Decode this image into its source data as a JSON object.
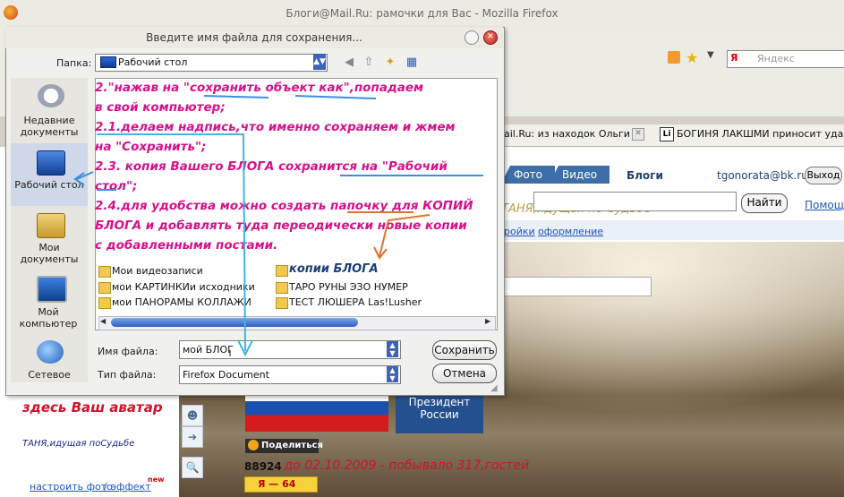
{
  "window": {
    "title": "Блоги@Mail.Ru: рамочки для Вас - Mozilla Firefox"
  },
  "browser": {
    "search_placeholder": "Яндекс",
    "search_logo": "Я",
    "tabs": [
      {
        "label": "ail.Ru: из находок Ольги ..."
      },
      {
        "label": "БОГИНЯ ЛАКШМИ приносит удачу,...",
        "icon_text": "Li"
      }
    ]
  },
  "page": {
    "nav_tabs": [
      "Фото",
      "Видео"
    ],
    "nav_active": "Блоги",
    "user_email": "tgonorata@bk.ru",
    "logout_label": "Выход",
    "find_label": "Найти",
    "help_link": "Помощ",
    "ghost_text": "ТАНЯ,идущая по Судьбе",
    "links": [
      "ройки",
      "оформление"
    ],
    "avatar_text": "здесь Ваш аватар",
    "avatar_sub": "ТАНЯ,идущая поСудьбе",
    "photo_link": "настроить фото",
    "effect_link": "эффект",
    "separator": "/",
    "new_badge": "new",
    "president_text": "Президент России",
    "share_label": "Поделиться",
    "counter": "88924",
    "counter_text": "- до 02.10.2009 - побывало 317,гостей",
    "ya_badge": "Я — 64"
  },
  "dialog": {
    "title": "Введите имя файла для сохранения...",
    "folder_label": "Папка:",
    "folder_value": "Рабочий стол",
    "places": [
      {
        "label": "Недавние документы",
        "icon": "recent-docs-icon"
      },
      {
        "label": "Рабочий стол",
        "icon": "desktop-icon",
        "selected": true
      },
      {
        "label": "Мои документы",
        "icon": "my-documents-icon"
      },
      {
        "label": "Мой компьютер",
        "icon": "my-computer-icon"
      },
      {
        "label": "Сетевое",
        "icon": "network-icon"
      }
    ],
    "files": [
      {
        "name": "Мои видеозаписи"
      },
      {
        "name": "мои КАРТИНКИи исходники"
      },
      {
        "name": "мои ПАНОРАМЫ КОЛЛАЖИ"
      },
      {
        "name": "копии БЛОГА"
      },
      {
        "name": "ТАРО РУНЫ ЭЗО НУМЕР"
      },
      {
        "name": "ТЕСТ ЛЮШЕРА Las!Lusher"
      }
    ],
    "filename_label": "Имя файла:",
    "filename_value": "мой БЛОГ",
    "filetype_label": "Тип файла:",
    "filetype_value": "Firefox Document",
    "save_label": "Сохранить",
    "cancel_label": "Отмена"
  },
  "annotation": {
    "color": "#d6108b",
    "lines": [
      "2.\"нажав на \"сохранить объект как\",попадаем",
      "в свой компьютер;",
      "2.1.делаем надпись,что именно сохраняем и жмем",
      "на \"Сохранить\";",
      "2.3. копия Вашего БЛОГА сохранится на \"Рабочий",
      "стол\";",
      "2.4.для удобства можно создать папочку для КОПИЙ",
      "БЛОГА и добавлять туда переодически новые копии",
      "с добавленными постами."
    ]
  }
}
